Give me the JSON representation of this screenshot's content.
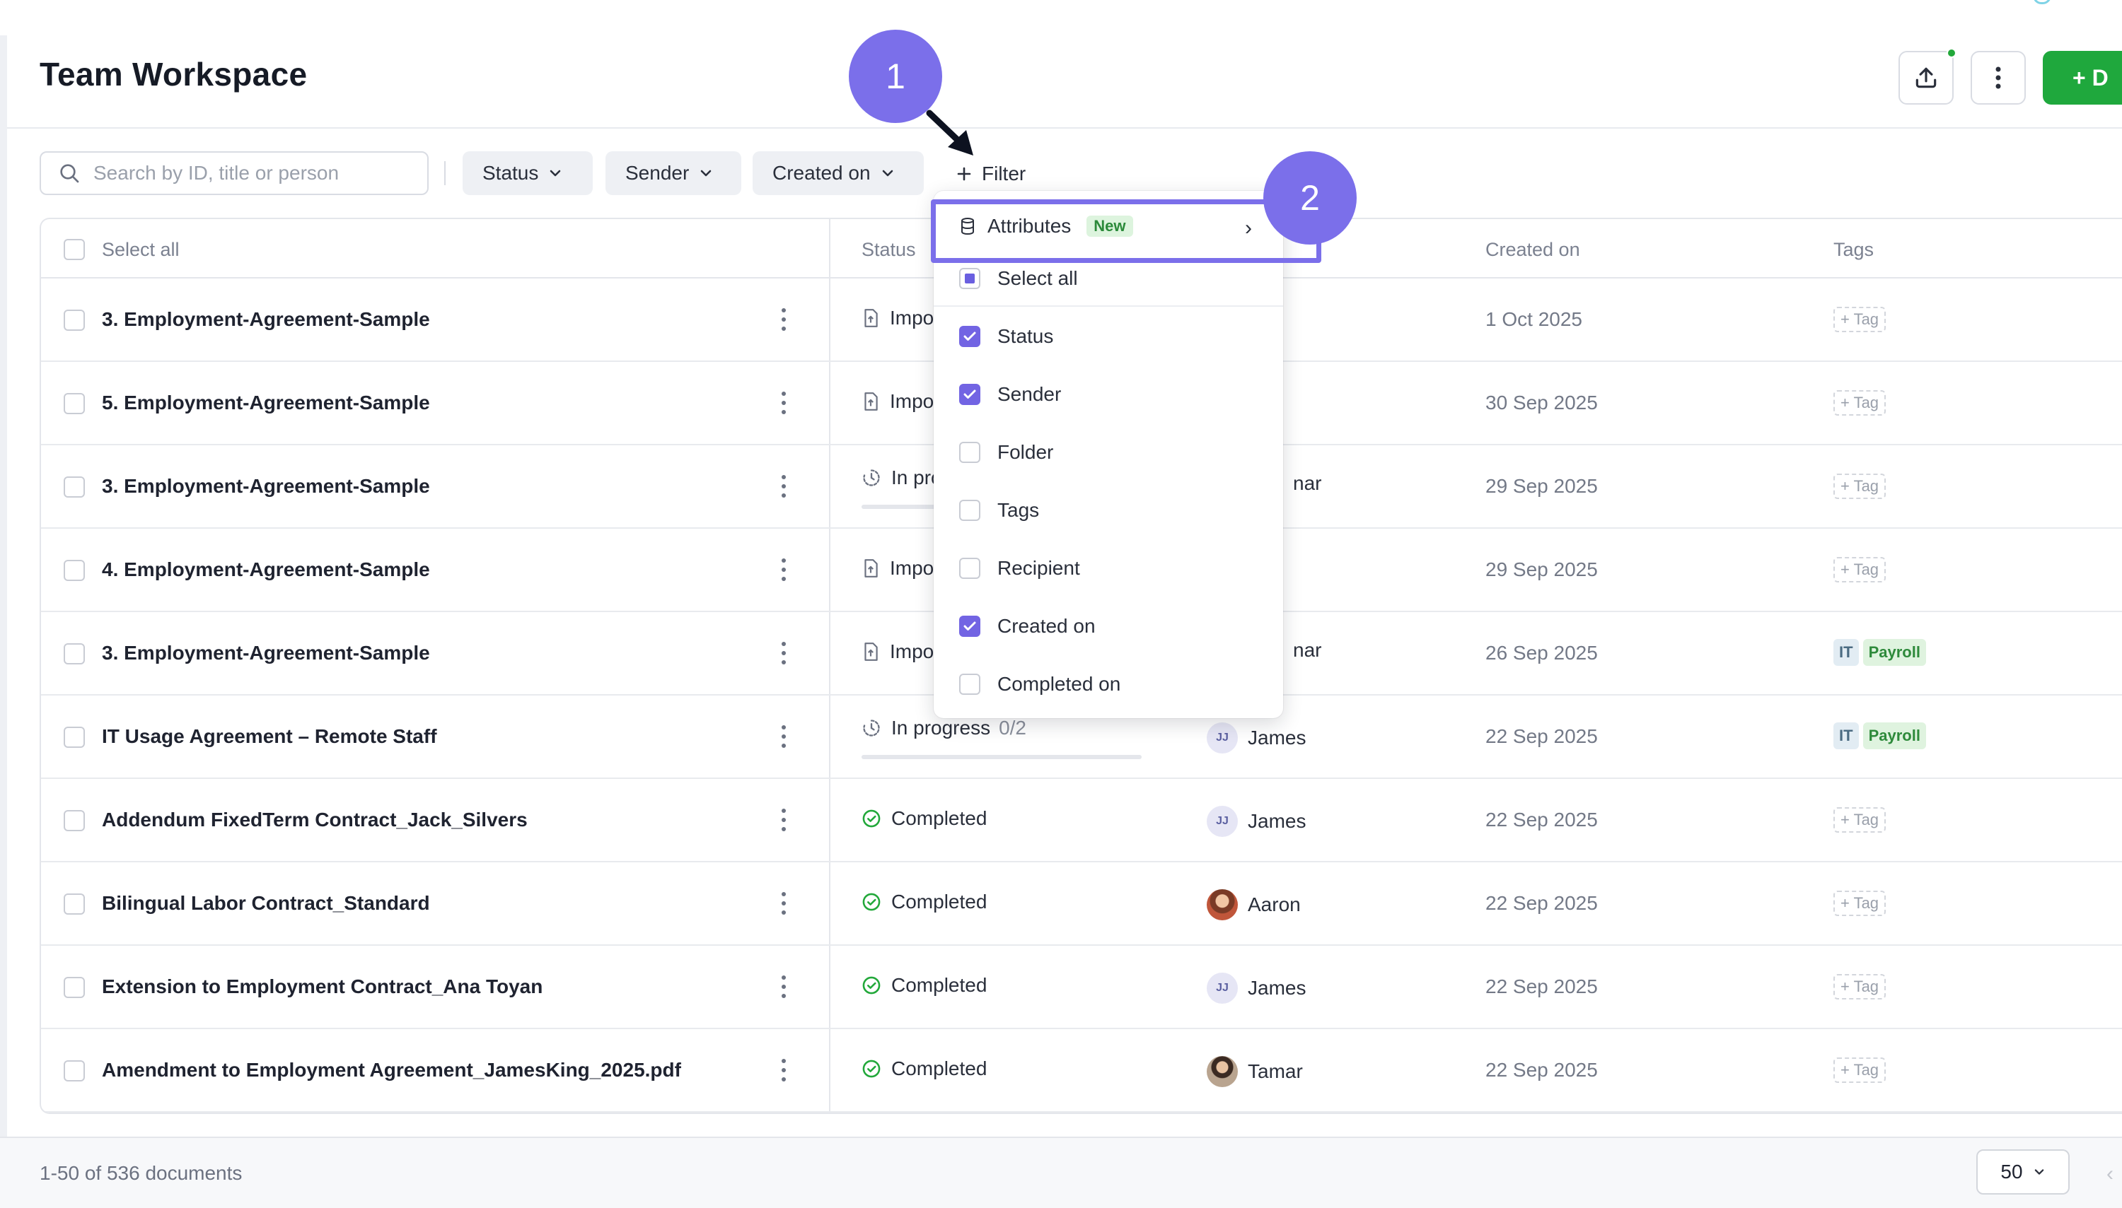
{
  "header": {
    "title": "Team Workspace",
    "create_label": "+ D"
  },
  "toolbar": {
    "search_placeholder": "Search by ID, title or person",
    "chips": [
      "Status",
      "Sender",
      "Created on"
    ],
    "filter_label": "Filter"
  },
  "table": {
    "headers": {
      "select_all": "Select all",
      "status": "Status",
      "created_on": "Created on",
      "tags": "Tags"
    },
    "rows": [
      {
        "title": "3. Employment-Agreement-Sample",
        "status": "Impo",
        "date": "1 Oct 2025",
        "tag_add": "+ Tag"
      },
      {
        "title": "5. Employment-Agreement-Sample",
        "status": "Impo",
        "date": "30 Sep 2025",
        "tag_add": "+ Tag"
      },
      {
        "title": "3. Employment-Agreement-Sample",
        "status": "In pro",
        "sender": "nar",
        "date": "29 Sep 2025",
        "tag_add": "+ Tag"
      },
      {
        "title": "4. Employment-Agreement-Sample",
        "status": "Impo",
        "date": "29 Sep 2025",
        "tag_add": "+ Tag"
      },
      {
        "title": "3. Employment-Agreement-Sample",
        "status": "Impo",
        "sender": "nar",
        "date": "26 Sep 2025",
        "tags": [
          "IT",
          "Payroll"
        ]
      },
      {
        "title": "IT Usage Agreement – Remote Staff",
        "status": "In progress",
        "count": "0/2",
        "avatar": "JJ",
        "sender": "James",
        "date": "22 Sep 2025",
        "tags": [
          "IT",
          "Payroll"
        ]
      },
      {
        "title": "Addendum FixedTerm Contract_Jack_Silvers",
        "status": "Completed",
        "avatar": "JJ",
        "sender": "James",
        "date": "22 Sep 2025",
        "tag_add": "+ Tag"
      },
      {
        "title": "Bilingual Labor Contract_Standard",
        "status": "Completed",
        "sender": "Aaron",
        "date": "22 Sep 2025",
        "tag_add": "+ Tag"
      },
      {
        "title": "Extension to Employment Contract_Ana Toyan",
        "status": "Completed",
        "avatar": "JJ",
        "sender": "James",
        "date": "22 Sep 2025",
        "tag_add": "+ Tag"
      },
      {
        "title": "Amendment to Employment Agreement_JamesKing_2025.pdf",
        "status": "Completed",
        "sender": "Tamar",
        "date": "22 Sep 2025",
        "tag_add": "+ Tag"
      }
    ]
  },
  "footer": {
    "count": "1-50 of 536 documents",
    "page_size": "50"
  },
  "dropdown": {
    "attributes_label": "Attributes",
    "new_badge": "New",
    "select_all": "Select all",
    "items": [
      {
        "label": "Status",
        "checked": true
      },
      {
        "label": "Sender",
        "checked": true
      },
      {
        "label": "Folder",
        "checked": false
      },
      {
        "label": "Tags",
        "checked": false
      },
      {
        "label": "Recipient",
        "checked": false
      },
      {
        "label": "Created on",
        "checked": true
      },
      {
        "label": "Completed on",
        "checked": false
      }
    ]
  },
  "callouts": [
    "1",
    "2"
  ],
  "colors": {
    "accent": "#7b6fea",
    "checkbox": "#7264e3",
    "primary_green": "#1fa83d",
    "completed_green": "#22a83a"
  },
  "icons": {
    "search": "search-icon",
    "upload": "upload-icon",
    "more": "more-vertical-icon",
    "filter": "plus-icon",
    "attributes": "database-icon",
    "status_imported": "file-import-icon",
    "status_in_progress": "clock-icon",
    "status_completed": "check-circle-icon"
  }
}
